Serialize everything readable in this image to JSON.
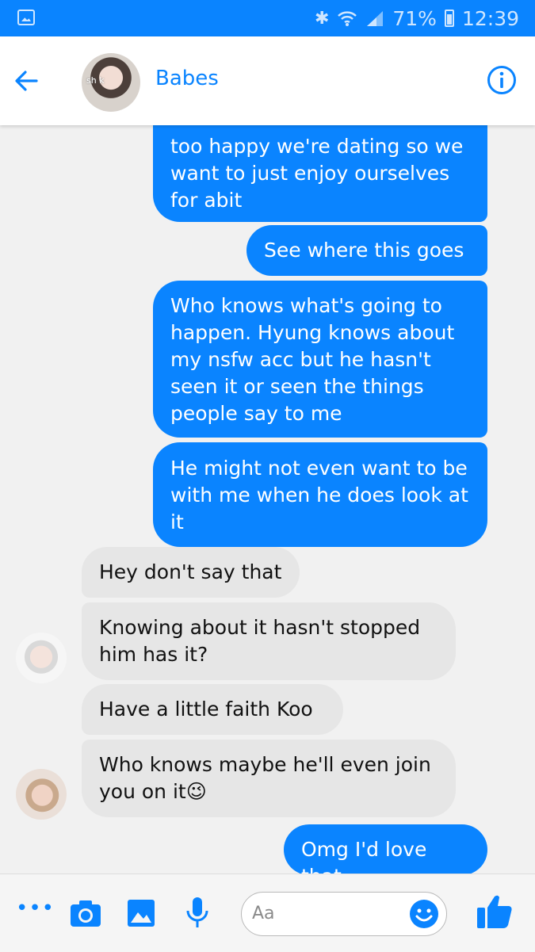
{
  "status_bar": {
    "battery": "71%",
    "time": "12:39"
  },
  "header": {
    "title": "Babes",
    "avatar_caption": "sh    k"
  },
  "messages": [
    {
      "from": "me",
      "text": "too happy we're dating so we\nwant to just enjoy ourselves\nfor abit"
    },
    {
      "from": "me",
      "text": "See where this goes"
    },
    {
      "from": "me",
      "text": "Who knows what's going to\nhappen. Hyung knows about\nmy nsfw acc but he hasn't\nseen it or seen the things\npeople say to me"
    },
    {
      "from": "me",
      "text": "He might not even want to be\nwith me when he does look at\nit"
    },
    {
      "from": "them",
      "text": "Hey don't say that"
    },
    {
      "from": "them",
      "text": "Knowing about it hasn't stopped\nhim has it?"
    },
    {
      "from": "them",
      "text": "Have a little faith Koo"
    },
    {
      "from": "them",
      "text": "Who knows maybe he'll even join\nyou on it😉"
    },
    {
      "from": "me",
      "text": "Omg I'd love that"
    }
  ],
  "composer": {
    "placeholder": "Aa",
    "more_label": "•••"
  },
  "colors": {
    "accent": "#0a84ff",
    "incoming_bubble": "#e6e6e6",
    "background": "#f1f1f1"
  },
  "icons": [
    "back-arrow-icon",
    "info-icon",
    "more-icon",
    "camera-icon",
    "image-icon",
    "microphone-icon",
    "emoji-icon",
    "thumbs-up-icon",
    "bluetooth-icon",
    "wifi-icon",
    "signal-icon",
    "battery-icon",
    "gallery-notification-icon"
  ]
}
